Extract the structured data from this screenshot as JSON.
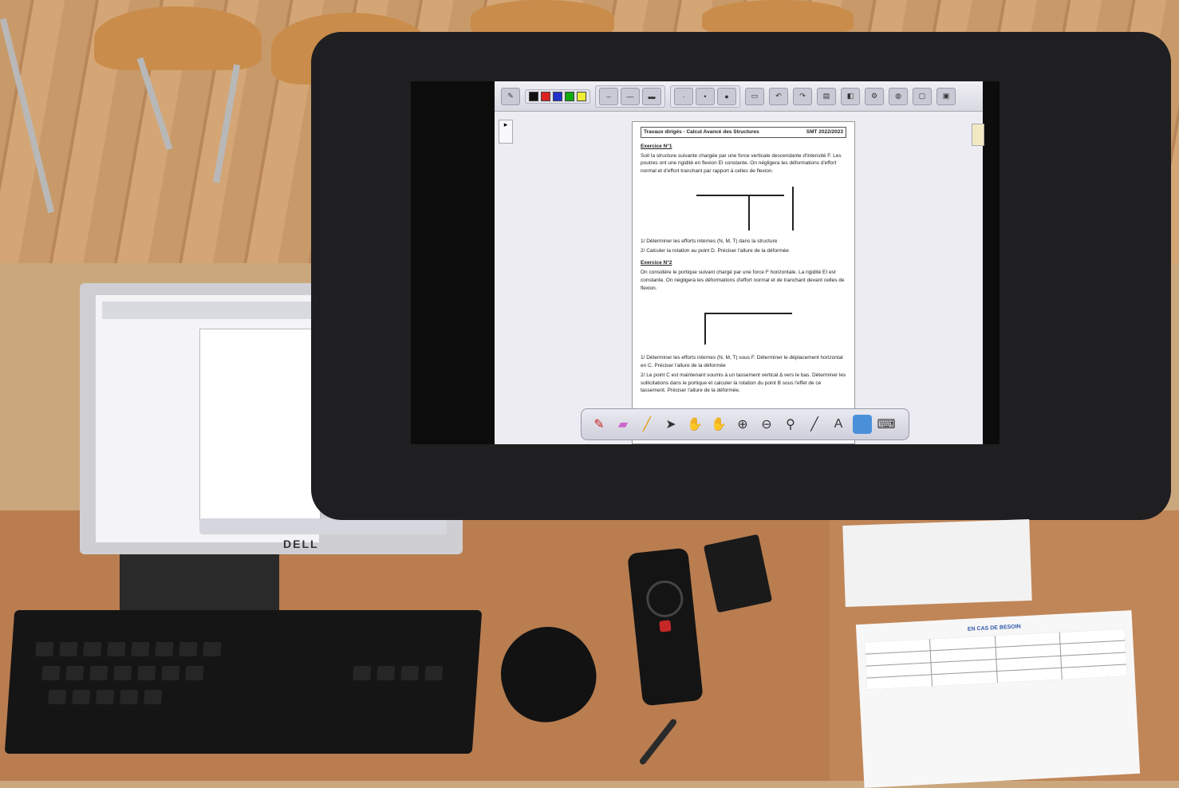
{
  "scene": "photo",
  "dell_monitor": {
    "brand_label": "DELL"
  },
  "wacom_app": {
    "toolbar": {
      "buttons": [
        "undo",
        "colors",
        "lines",
        "thickness",
        "clear",
        "page",
        "layers"
      ]
    },
    "document": {
      "header_left": "Travaux dirigés - Calcul Avancé des Structures",
      "header_right": "SMT 2022/2023",
      "exercise1_title": "Exercice N°1",
      "exercise1_text": "Soit la structure suivante chargée par une force verticale descendante d'intensité F. Les poutres ont une rigidité en flexion EI constante. On négligera les déformations d'effort normal et d'effort tranchant par rapport à celles de flexion.",
      "exercise1_q1": "1/ Déterminer les efforts internes (N, M, T) dans la structure",
      "exercise1_q2": "2/ Calculer la rotation au point D. Préciser l'allure de la déformée",
      "exercise2_title": "Exercice N°2",
      "exercise2_text": "On considère le portique suivant chargé par une force F horizontale. La rigidité EI est constante. On négligera les déformations d'effort normal et de tranchant devant celles de flexion.",
      "exercise2_q1": "1/ Déterminer les efforts internes (N, M, T) sous F. Déterminer le déplacement horizontal en C. Préciser l'allure de la déformée",
      "exercise2_q2": "2/ Le point C est maintenant soumis à un tassement vertical Δ vers le bas. Déterminer les sollicitations dans le portique et calculer la rotation du point B sous l'effet de ce tassement. Préciser l'allure de la déformée."
    },
    "floating_toolbar": [
      "pen",
      "eraser",
      "highlighter",
      "pointer",
      "hand",
      "pan",
      "zoom-in",
      "zoom-out",
      "spotlight",
      "line",
      "text",
      "screen",
      "keyboard"
    ]
  },
  "notice_bottom": {
    "title": "EN CAS DE BESOIN"
  }
}
